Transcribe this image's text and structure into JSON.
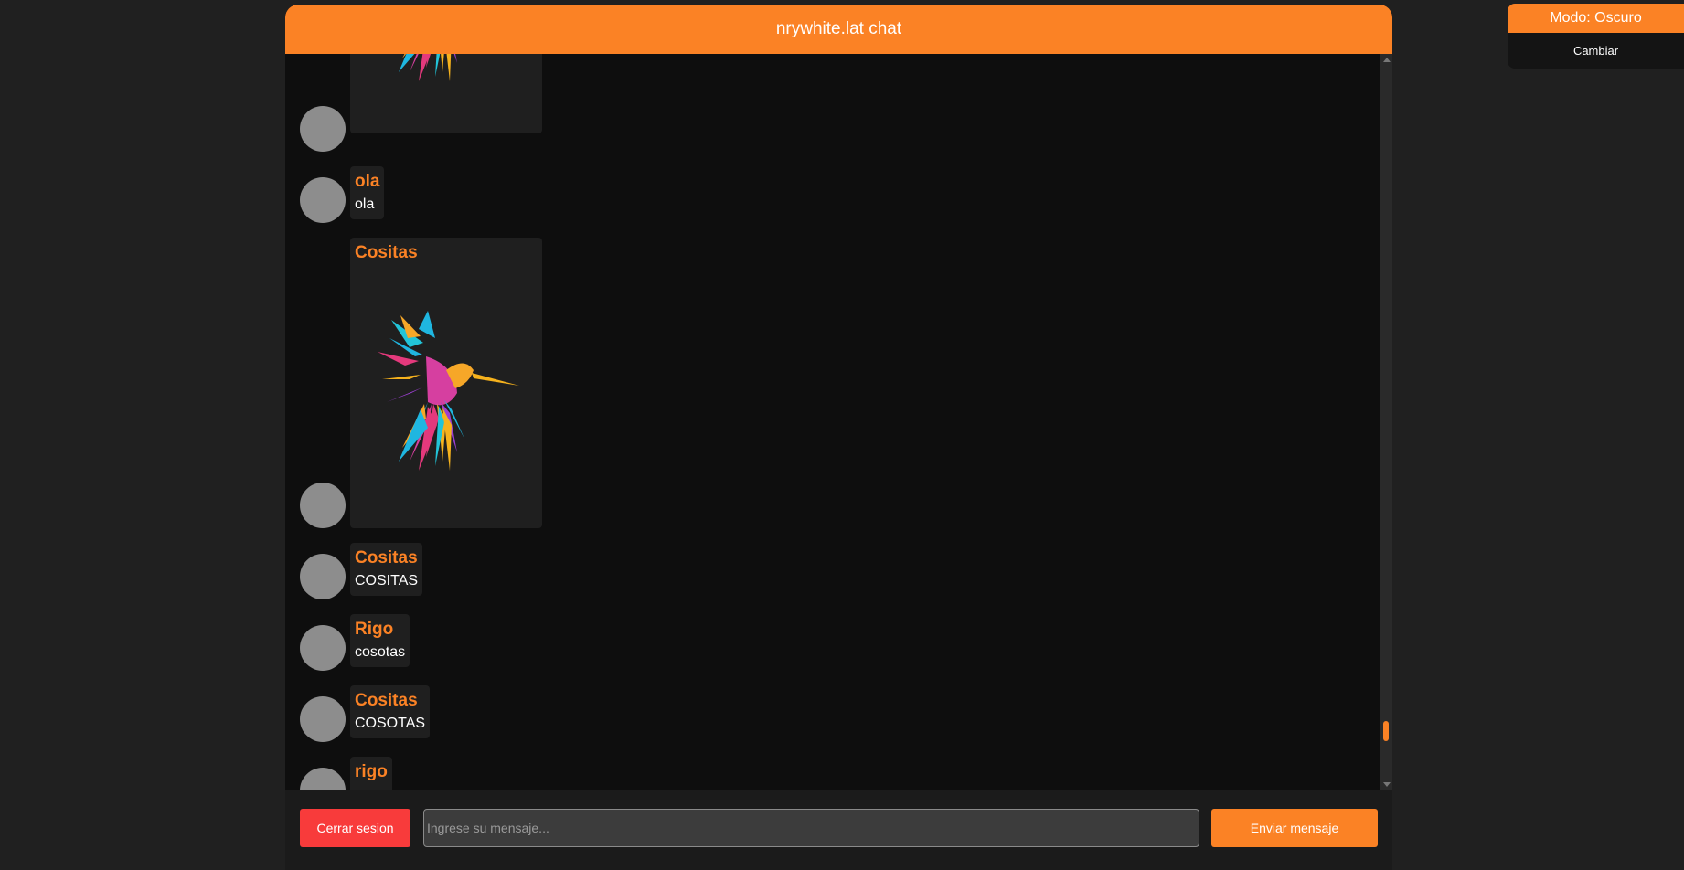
{
  "header": {
    "title": "nrywhite.lat chat"
  },
  "messages": [
    {
      "author": "",
      "text": "",
      "has_image": true,
      "partial": true
    },
    {
      "author": "ola",
      "text": "ola"
    },
    {
      "author": "Cositas",
      "text": "",
      "has_image": true
    },
    {
      "author": "Cositas",
      "text": "COSITAS"
    },
    {
      "author": "Rigo",
      "text": "cosotas"
    },
    {
      "author": "Cositas",
      "text": "COSOTAS"
    },
    {
      "author": "rigo",
      "text": ""
    }
  ],
  "footer": {
    "logout_label": "Cerrar sesion",
    "input_placeholder": "Ingrese su mensaje...",
    "send_label": "Enviar mensaje"
  },
  "mode": {
    "title": "Modo: Oscuro",
    "toggle_label": "Cambiar"
  },
  "colors": {
    "accent": "#fb8225",
    "danger": "#f83b3b",
    "background": "#202020",
    "chat_background": "#0e0e0e"
  }
}
